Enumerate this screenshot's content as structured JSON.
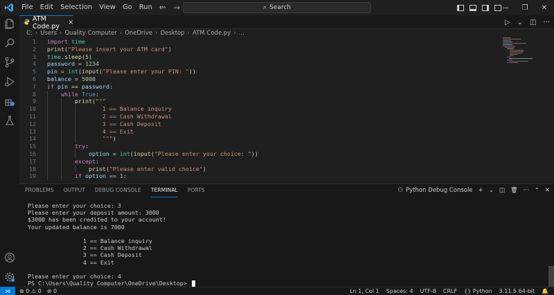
{
  "menu": [
    "File",
    "Edit",
    "Selection",
    "View",
    "Go",
    "Run",
    "···"
  ],
  "search": {
    "label": "Search"
  },
  "tab": {
    "filename": "ATM Code.py"
  },
  "breadcrumbs": [
    "C:",
    "Users",
    "Quality Computer",
    "OneDrive",
    "Desktop",
    "ATM Code.py",
    "..."
  ],
  "code_lines": [
    {
      "n": "1",
      "indent": 0,
      "tokens": [
        [
          "kw",
          "import"
        ],
        [
          "pl",
          " "
        ],
        [
          "cls",
          "time"
        ]
      ]
    },
    {
      "n": "2",
      "indent": 0,
      "tokens": [
        [
          "fn",
          "print"
        ],
        [
          "pl",
          "("
        ],
        [
          "str",
          "\"Please insert your ATM card\""
        ],
        [
          "pl",
          ")"
        ]
      ]
    },
    {
      "n": "3",
      "indent": 0,
      "tokens": [
        [
          "cls",
          "time"
        ],
        [
          "pl",
          "."
        ],
        [
          "fn",
          "sleep"
        ],
        [
          "pl",
          "("
        ],
        [
          "num",
          "5"
        ],
        [
          "pl",
          ")"
        ]
      ]
    },
    {
      "n": "4",
      "indent": 0,
      "tokens": [
        [
          "var",
          "password"
        ],
        [
          "pl",
          " = "
        ],
        [
          "num",
          "1234"
        ]
      ]
    },
    {
      "n": "5",
      "indent": 0,
      "tokens": [
        [
          "var",
          "pin"
        ],
        [
          "pl",
          " = "
        ],
        [
          "cls",
          "int"
        ],
        [
          "pl",
          "("
        ],
        [
          "fn",
          "input"
        ],
        [
          "pl",
          "("
        ],
        [
          "str",
          "\"Please enter your PIN: \""
        ],
        [
          "pl",
          "))"
        ]
      ]
    },
    {
      "n": "6",
      "indent": 0,
      "tokens": [
        [
          "var",
          "balance"
        ],
        [
          "pl",
          " = "
        ],
        [
          "num",
          "5000"
        ]
      ]
    },
    {
      "n": "7",
      "indent": 0,
      "tokens": [
        [
          "kw",
          "if"
        ],
        [
          "pl",
          " "
        ],
        [
          "var",
          "pin"
        ],
        [
          "pl",
          " == "
        ],
        [
          "var",
          "password"
        ],
        [
          "pl",
          ":"
        ]
      ]
    },
    {
      "n": "8",
      "indent": 1,
      "tokens": [
        [
          "kw",
          "while"
        ],
        [
          "pl",
          " "
        ],
        [
          "bl",
          "True"
        ],
        [
          "pl",
          ":"
        ]
      ]
    },
    {
      "n": "9",
      "indent": 2,
      "tokens": [
        [
          "fn",
          "print"
        ],
        [
          "pl",
          "("
        ],
        [
          "str",
          "\"\"\""
        ]
      ]
    },
    {
      "n": "10",
      "indent": 0,
      "tokens": [
        [
          "str",
          "                1 == Balance inquiry"
        ]
      ]
    },
    {
      "n": "11",
      "indent": 0,
      "tokens": [
        [
          "str",
          "                2 == Cash Withdrawal"
        ]
      ]
    },
    {
      "n": "12",
      "indent": 0,
      "tokens": [
        [
          "str",
          "                3 == Cash Deposit"
        ]
      ]
    },
    {
      "n": "13",
      "indent": 0,
      "tokens": [
        [
          "str",
          "                4 == Exit"
        ]
      ]
    },
    {
      "n": "14",
      "indent": 0,
      "tokens": [
        [
          "str",
          "                \"\"\""
        ],
        [
          "pl",
          ")"
        ]
      ]
    },
    {
      "n": "15",
      "indent": 2,
      "tokens": [
        [
          "kw",
          "try"
        ],
        [
          "pl",
          ":"
        ]
      ]
    },
    {
      "n": "16",
      "indent": 3,
      "tokens": [
        [
          "var",
          "option"
        ],
        [
          "pl",
          " = "
        ],
        [
          "cls",
          "int"
        ],
        [
          "pl",
          "("
        ],
        [
          "fn",
          "input"
        ],
        [
          "pl",
          "("
        ],
        [
          "str",
          "\"Please enter your choice: \""
        ],
        [
          "pl",
          "))"
        ]
      ]
    },
    {
      "n": "17",
      "indent": 2,
      "tokens": [
        [
          "kw",
          "except"
        ],
        [
          "pl",
          ":"
        ]
      ]
    },
    {
      "n": "18",
      "indent": 3,
      "tokens": [
        [
          "fn",
          "print"
        ],
        [
          "pl",
          "("
        ],
        [
          "str",
          "\"Please enter valid choice\""
        ],
        [
          "pl",
          ")"
        ]
      ]
    },
    {
      "n": "19",
      "indent": 2,
      "tokens": [
        [
          "kw",
          "if"
        ],
        [
          "pl",
          " "
        ],
        [
          "var",
          "option"
        ],
        [
          "pl",
          " == "
        ],
        [
          "num",
          "1"
        ],
        [
          "pl",
          ":"
        ]
      ]
    }
  ],
  "panel": {
    "tabs": [
      "PROBLEMS",
      "OUTPUT",
      "DEBUG CONSOLE",
      "TERMINAL",
      "PORTS"
    ],
    "active_tab": "TERMINAL",
    "terminal_profile": "Python Debug Console"
  },
  "terminal_lines": [
    "Please enter your choice: 3",
    "Please enter your deposit amount: 3000",
    "$3000 has been credited to your account!",
    "Your updated balance is 7000",
    "",
    "                1 == Balance inquiry",
    "                2 == Cash Withdrawal",
    "                3 == Cash Deposit",
    "                4 == Exit",
    "",
    "Please enter your choice: 4",
    "PS C:\\Users\\Quality Computer\\OneDrive\\Desktop> "
  ],
  "status": {
    "errors": "0",
    "warnings": "0",
    "ports": "0",
    "position": "Ln 1, Col 1",
    "spaces": "Spaces: 4",
    "encoding": "UTF-8",
    "eol": "CRLF",
    "language": "Python",
    "interpreter": "3.11.5 64-bit"
  },
  "colors": {
    "accent": "#0078d4",
    "background": "#1f1f1f",
    "sidebar": "#181818"
  }
}
